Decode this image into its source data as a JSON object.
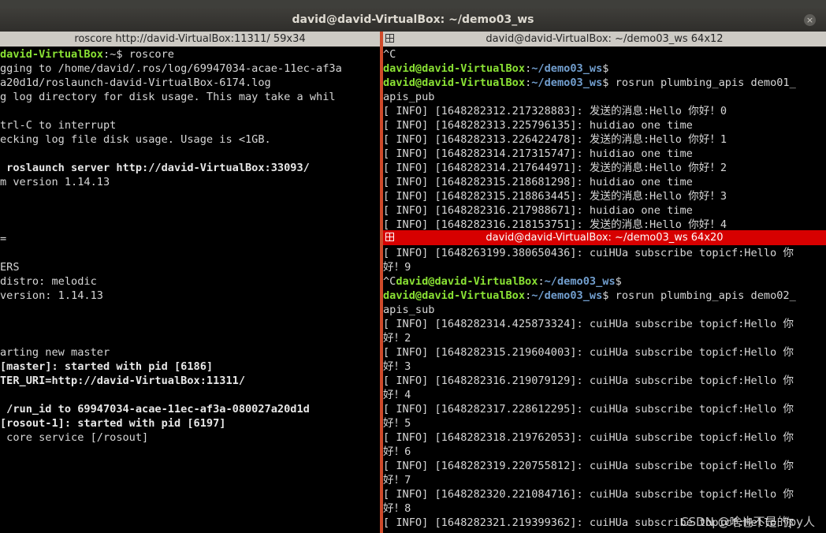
{
  "window": {
    "title": "david@david-VirtualBox: ~/demo03_ws",
    "close_glyph": "×"
  },
  "left_pane": {
    "header": "roscore http://david-VirtualBox:11311/ 59x34",
    "lines": [
      [
        {
          "t": "david-VirtualBox",
          "c": "g"
        },
        {
          "t": ":~$ roscore"
        }
      ],
      [
        {
          "t": "gging to /home/david/.ros/log/69947034-acae-11ec-af3a"
        }
      ],
      [
        {
          "t": "a20d1d/roslaunch-david-VirtualBox-6174.log"
        }
      ],
      [
        {
          "t": "g log directory for disk usage. This may take a whil"
        }
      ],
      [
        {
          "t": ""
        }
      ],
      [
        {
          "t": "trl-C to interrupt"
        }
      ],
      [
        {
          "t": "ecking log file disk usage. Usage is <1GB."
        }
      ],
      [
        {
          "t": ""
        }
      ],
      [
        {
          "t": " roslaunch server http://david-VirtualBox:33093/",
          "c": "bold"
        }
      ],
      [
        {
          "t": "m version 1.14.13"
        }
      ],
      [
        {
          "t": ""
        }
      ],
      [
        {
          "t": ""
        }
      ],
      [
        {
          "t": ""
        }
      ],
      [
        {
          "t": "="
        }
      ],
      [
        {
          "t": ""
        }
      ],
      [
        {
          "t": "ERS"
        }
      ],
      [
        {
          "t": "distro: melodic"
        }
      ],
      [
        {
          "t": "version: 1.14.13"
        }
      ],
      [
        {
          "t": ""
        }
      ],
      [
        {
          "t": ""
        }
      ],
      [
        {
          "t": ""
        }
      ],
      [
        {
          "t": "arting new master"
        }
      ],
      [
        {
          "t": "[master]: started with pid [6186]",
          "c": "bold"
        }
      ],
      [
        {
          "t": "TER_URI=http://david-VirtualBox:11311/",
          "c": "bold"
        }
      ],
      [
        {
          "t": ""
        }
      ],
      [
        {
          "t": " /run_id to 69947034-acae-11ec-af3a-080027a20d1d",
          "c": "bold"
        }
      ],
      [
        {
          "t": "[rosout-1]: started with pid [6197]",
          "c": "bold"
        }
      ],
      [
        {
          "t": " core service [/rosout]"
        }
      ]
    ]
  },
  "top_right_pane": {
    "header": "david@david-VirtualBox: ~/demo03_ws 64x12",
    "lines": [
      [
        {
          "t": "^C"
        }
      ],
      [
        {
          "t": "david@david-VirtualBox",
          "c": "g"
        },
        {
          "t": ":"
        },
        {
          "t": "~/demo03_ws",
          "c": "b"
        },
        {
          "t": "$"
        }
      ],
      [
        {
          "t": "david@david-VirtualBox",
          "c": "g"
        },
        {
          "t": ":"
        },
        {
          "t": "~/demo03_ws",
          "c": "b"
        },
        {
          "t": "$ rosrun plumbing_apis demo01_"
        }
      ],
      [
        {
          "t": "apis_pub"
        }
      ],
      [
        {
          "t": "[ INFO] [1648282312.217328883]: 发送的消息:Hello 你好！0"
        }
      ],
      [
        {
          "t": "[ INFO] [1648282313.225796135]: huidiao one time"
        }
      ],
      [
        {
          "t": "[ INFO] [1648282313.226422478]: 发送的消息:Hello 你好！1"
        }
      ],
      [
        {
          "t": "[ INFO] [1648282314.217315747]: huidiao one time"
        }
      ],
      [
        {
          "t": "[ INFO] [1648282314.217644971]: 发送的消息:Hello 你好！2"
        }
      ],
      [
        {
          "t": "[ INFO] [1648282315.218681298]: huidiao one time"
        }
      ],
      [
        {
          "t": "[ INFO] [1648282315.218863445]: 发送的消息:Hello 你好！3"
        }
      ],
      [
        {
          "t": "[ INFO] [1648282316.217988671]: huidiao one time"
        }
      ],
      [
        {
          "t": "[ INFO] [1648282316.218153751]: 发送的消息:Hello 你好！4"
        }
      ]
    ]
  },
  "bottom_right_pane": {
    "header": "david@david-VirtualBox: ~/demo03_ws 64x20",
    "lines": [
      [
        {
          "t": "[ INFO] [1648263199.380650436]: cuiHUa subscribe topicf:Hello 你"
        }
      ],
      [
        {
          "t": "好！9"
        }
      ],
      [
        {
          "t": "^C"
        },
        {
          "t": "david@david-VirtualBox",
          "c": "g"
        },
        {
          "t": ":"
        },
        {
          "t": "~/demo03_ws",
          "c": "b"
        },
        {
          "t": "$"
        }
      ],
      [
        {
          "t": "david@david-VirtualBox",
          "c": "g"
        },
        {
          "t": ":"
        },
        {
          "t": "~/demo03_ws",
          "c": "b"
        },
        {
          "t": "$ rosrun plumbing_apis demo02_"
        }
      ],
      [
        {
          "t": "apis_sub"
        }
      ],
      [
        {
          "t": "[ INFO] [1648282314.425873324]: cuiHUa subscribe topicf:Hello 你"
        }
      ],
      [
        {
          "t": "好！2"
        }
      ],
      [
        {
          "t": "[ INFO] [1648282315.219604003]: cuiHUa subscribe topicf:Hello 你"
        }
      ],
      [
        {
          "t": "好！3"
        }
      ],
      [
        {
          "t": "[ INFO] [1648282316.219079129]: cuiHUa subscribe topicf:Hello 你"
        }
      ],
      [
        {
          "t": "好！4"
        }
      ],
      [
        {
          "t": "[ INFO] [1648282317.228612295]: cuiHUa subscribe topicf:Hello 你"
        }
      ],
      [
        {
          "t": "好！5"
        }
      ],
      [
        {
          "t": "[ INFO] [1648282318.219762053]: cuiHUa subscribe topicf:Hello 你"
        }
      ],
      [
        {
          "t": "好！6"
        }
      ],
      [
        {
          "t": "[ INFO] [1648282319.220755812]: cuiHUa subscribe topicf:Hello 你"
        }
      ],
      [
        {
          "t": "好！7"
        }
      ],
      [
        {
          "t": "[ INFO] [1648282320.221084716]: cuiHUa subscribe topicf:Hello 你"
        }
      ],
      [
        {
          "t": "好！8"
        }
      ],
      [
        {
          "t": "[ INFO] [1648282321.219399362]: cuiHUa subscribe topicf:Hello 你"
        }
      ]
    ]
  },
  "watermark": "CSDN @啥也不是的py人",
  "colors": {
    "user_host": "#8ae234",
    "path": "#729fcf",
    "active_header": "#d70000",
    "inactive_header": "#cdcac4"
  }
}
